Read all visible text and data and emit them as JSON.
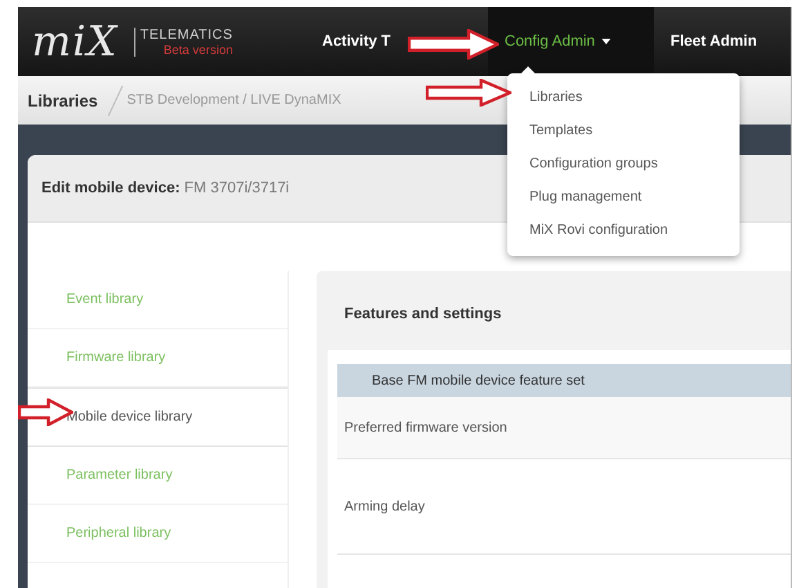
{
  "header": {
    "logo": "miX",
    "brand": "TELEMATICS",
    "edition": "Beta version",
    "nav": [
      {
        "label": "Activity T",
        "selected": false,
        "dropdown": false
      },
      {
        "label": "Config Admin",
        "selected": true,
        "dropdown": true
      },
      {
        "label": "Fleet Admin",
        "selected": false,
        "dropdown": false
      }
    ]
  },
  "dropdown": {
    "items": [
      "Libraries",
      "Templates",
      "Configuration groups",
      "Plug management",
      "MiX Rovi configuration"
    ]
  },
  "breadcrumb": {
    "title": "Libraries",
    "path": "STB Development / LIVE DynaMIX"
  },
  "panel": {
    "title_label": "Edit mobile device:",
    "title_value": "FM 3707i/3717i"
  },
  "sidebar": {
    "items": [
      {
        "label": "Event library",
        "selected": false
      },
      {
        "label": "Firmware library",
        "selected": false
      },
      {
        "label": "Mobile device library",
        "selected": true
      },
      {
        "label": "Parameter library",
        "selected": false
      },
      {
        "label": "Peripheral library",
        "selected": false
      }
    ]
  },
  "content": {
    "heading": "Features and settings",
    "group": "Base FM mobile device feature set",
    "rows": [
      "Preferred firmware version",
      "Arming delay"
    ]
  }
}
